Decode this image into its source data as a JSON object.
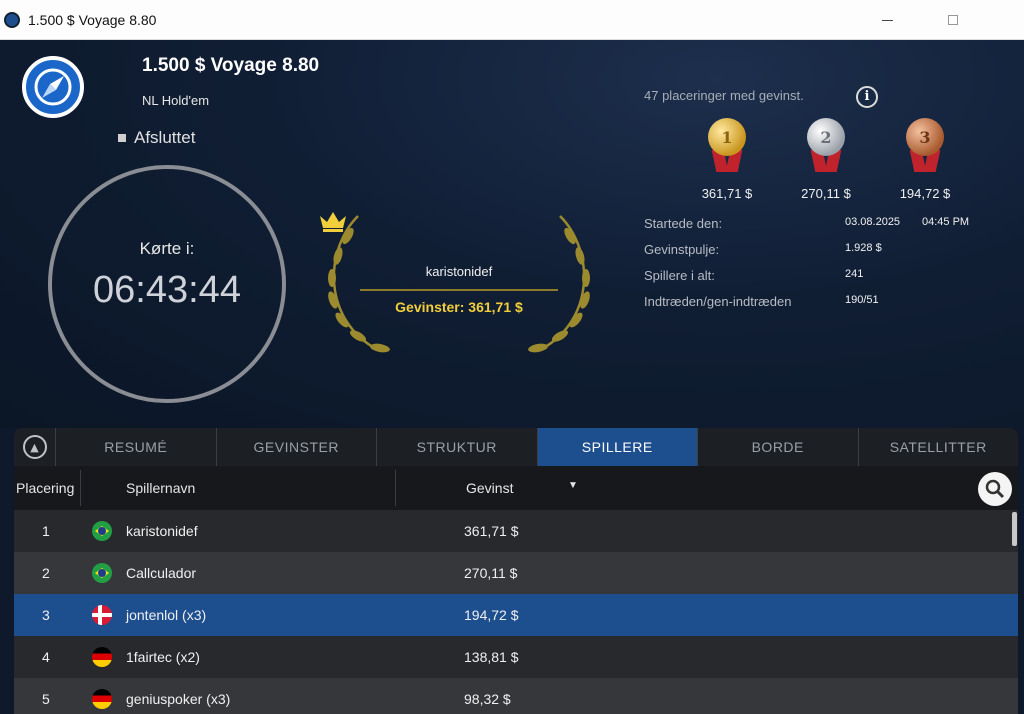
{
  "window": {
    "title": "1.500 $ Voyage 8.80",
    "icons": {
      "app": "app-logo-icon",
      "minimize": "minimize-icon",
      "maximize": "maximize-icon"
    }
  },
  "tournament": {
    "name": "1.500 $ Voyage 8.80",
    "game": "NL Hold'em",
    "status": "Afsluttet",
    "elapsed_label": "Kørte i:",
    "elapsed_time": "06:43:44"
  },
  "winner": {
    "name": "karistonidef",
    "prize_text": "Gevinster: 361,71 $"
  },
  "payouts": {
    "summary": "47 placeringer med gevinst.",
    "medals": [
      {
        "rank": "1",
        "prize": "361,71 $"
      },
      {
        "rank": "2",
        "prize": "270,11 $"
      },
      {
        "rank": "3",
        "prize": "194,72 $"
      }
    ]
  },
  "stats": {
    "started_label": "Startede den:",
    "started_date": "03.08.2025",
    "started_time": "04:45 PM",
    "pool_label": "Gevinstpulje:",
    "pool_value": "1.928 $",
    "players_label": "Spillere i alt:",
    "players_value": "241",
    "entries_label": "Indtræden/gen-indtræden",
    "entries_value": "190/51"
  },
  "tabs": [
    {
      "label": "RESUMÉ"
    },
    {
      "label": "GEVINSTER"
    },
    {
      "label": "STRUKTUR"
    },
    {
      "label": "SPILLERE",
      "active": true
    },
    {
      "label": "BORDE"
    },
    {
      "label": "SATELLITTER"
    }
  ],
  "table": {
    "headers": {
      "place": "Placering",
      "player": "Spillernavn",
      "winnings": "Gevinst"
    },
    "rows": [
      {
        "pos": "1",
        "flag": "brazil-flag-icon",
        "name": "karistonidef",
        "win": "361,71 $"
      },
      {
        "pos": "2",
        "flag": "brazil-flag-icon",
        "name": "Callculador",
        "win": "270,11 $"
      },
      {
        "pos": "3",
        "flag": "denmark-flag-icon",
        "name": "jontenlol (x3)",
        "win": "194,72 $",
        "selected": true
      },
      {
        "pos": "4",
        "flag": "germany-flag-icon",
        "name": "1fairtec (x2)",
        "win": "138,81 $"
      },
      {
        "pos": "5",
        "flag": "germany-flag-icon",
        "name": "geniuspoker (x3)",
        "win": "98,32 $"
      }
    ]
  },
  "colors": {
    "accent": "#1d4f8f",
    "gold_text": "#f2cf3a",
    "row_dark": "#27292d",
    "row_light": "#35373b",
    "selected_row": "#1d4f8f"
  }
}
